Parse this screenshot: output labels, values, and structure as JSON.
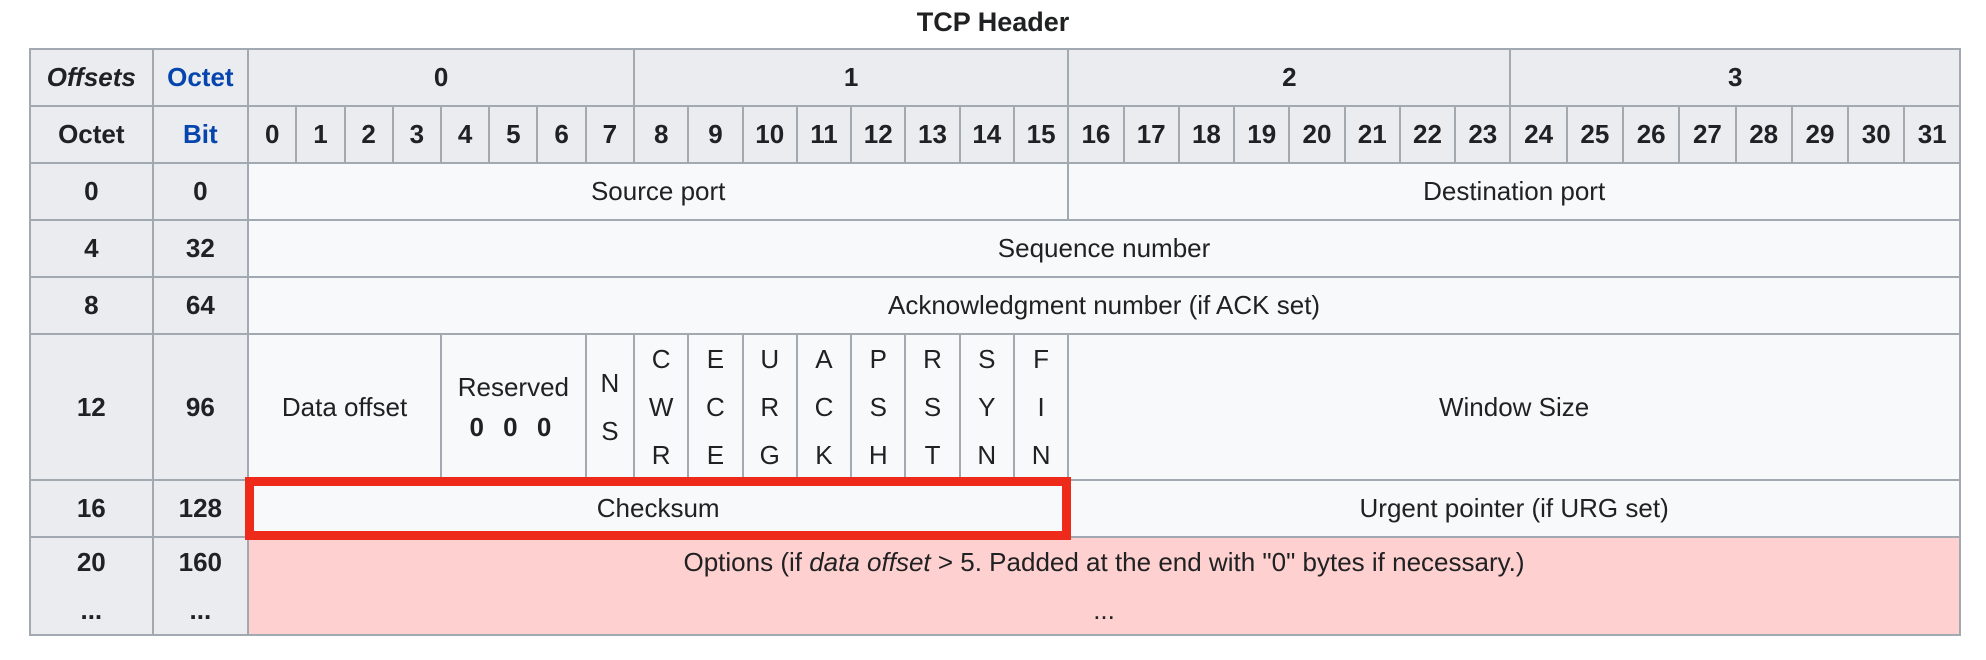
{
  "caption": "TCP Header",
  "header": {
    "offsets": "Offsets",
    "octet": "Octet",
    "bit": "Bit",
    "octet_numbers": [
      "0",
      "1",
      "2",
      "3"
    ],
    "bit_numbers": [
      "0",
      "1",
      "2",
      "3",
      "4",
      "5",
      "6",
      "7",
      "8",
      "9",
      "10",
      "11",
      "12",
      "13",
      "14",
      "15",
      "16",
      "17",
      "18",
      "19",
      "20",
      "21",
      "22",
      "23",
      "24",
      "25",
      "26",
      "27",
      "28",
      "29",
      "30",
      "31"
    ]
  },
  "rows": {
    "r0": {
      "octet": "0",
      "bit": "0",
      "source_port": "Source port",
      "destination_port": "Destination port"
    },
    "r4": {
      "octet": "4",
      "bit": "32",
      "sequence_number": "Sequence number"
    },
    "r8": {
      "octet": "8",
      "bit": "64",
      "ack_number": "Acknowledgment number (if ACK set)"
    },
    "r12": {
      "octet": "12",
      "bit": "96",
      "data_offset": "Data offset",
      "reserved": "Reserved",
      "reserved_bits": "0 0 0",
      "window_size": "Window Size",
      "flags": [
        {
          "name": "NS",
          "letters": [
            "N",
            "S"
          ]
        },
        {
          "name": "CWR",
          "letters": [
            "C",
            "W",
            "R"
          ]
        },
        {
          "name": "ECE",
          "letters": [
            "E",
            "C",
            "E"
          ]
        },
        {
          "name": "URG",
          "letters": [
            "U",
            "R",
            "G"
          ]
        },
        {
          "name": "ACK",
          "letters": [
            "A",
            "C",
            "K"
          ]
        },
        {
          "name": "PSH",
          "letters": [
            "P",
            "S",
            "H"
          ]
        },
        {
          "name": "RST",
          "letters": [
            "R",
            "S",
            "T"
          ]
        },
        {
          "name": "SYN",
          "letters": [
            "S",
            "Y",
            "N"
          ]
        },
        {
          "name": "FIN",
          "letters": [
            "F",
            "I",
            "N"
          ]
        }
      ]
    },
    "r16": {
      "octet": "16",
      "bit": "128",
      "checksum": "Checksum",
      "urgent_pointer": "Urgent pointer (if URG set)"
    },
    "r20": {
      "octet": "20",
      "bit": "160",
      "octet_cont": "...",
      "bit_cont": "...",
      "options_prefix": "Options (if ",
      "options_italic": "data offset",
      "options_suffix": " > 5. Padded at the end with \"0\" bytes if necessary.)",
      "options_cont": "..."
    }
  },
  "colors": {
    "header_bg": "#eaecf0",
    "cell_bg": "#f8f9fa",
    "border": "#a2a9b1",
    "options_bg": "#ffd0d0",
    "highlight": "#ee2a1a",
    "link_blue": "#0645ad"
  }
}
